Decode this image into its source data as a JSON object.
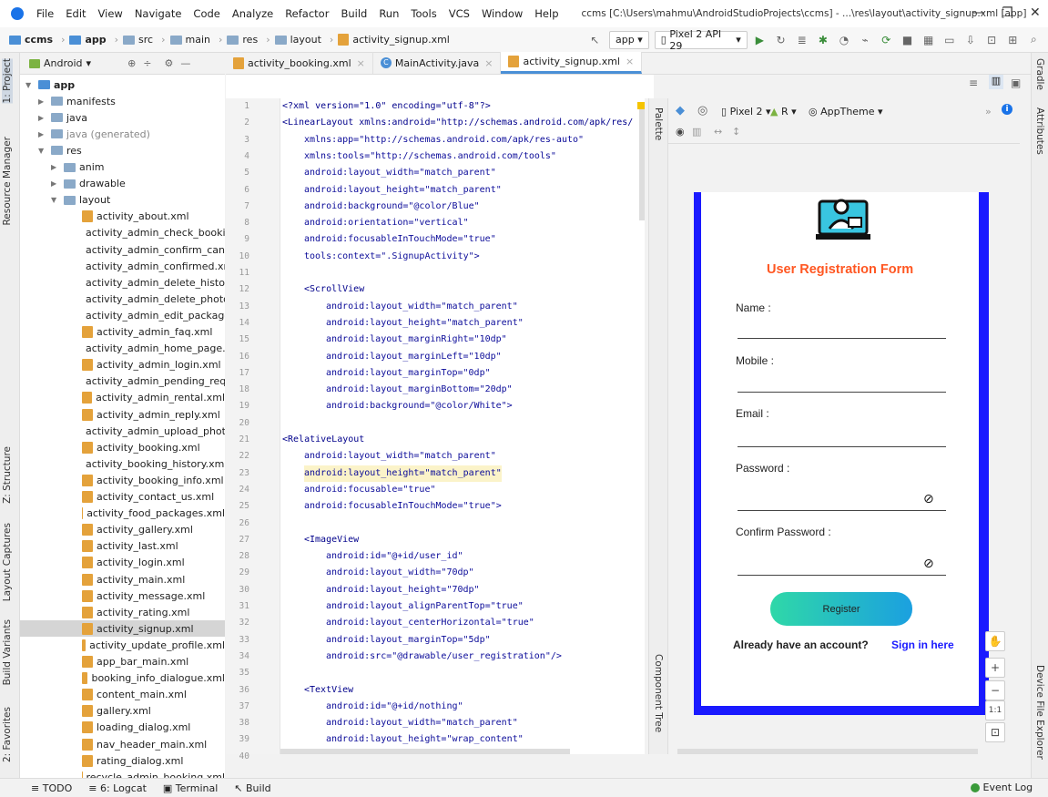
{
  "menubar": {
    "items": [
      "File",
      "Edit",
      "View",
      "Navigate",
      "Code",
      "Analyze",
      "Refactor",
      "Build",
      "Run",
      "Tools",
      "VCS",
      "Window",
      "Help"
    ],
    "title": "ccms [C:\\Users\\mahmu\\AndroidStudioProjects\\ccms] - ...\\res\\layout\\activity_signup.xml [app]"
  },
  "navbar": {
    "crumbs": [
      "ccms",
      "app",
      "src",
      "main",
      "res",
      "layout",
      "activity_signup.xml"
    ],
    "run_config": "app",
    "device": "Pixel 2 API 29"
  },
  "left_tabs": [
    "1: Project",
    "Resource Manager",
    "Z: Structure",
    "Layout Captures",
    "Build Variants",
    "2: Favorites"
  ],
  "right_tabs": [
    "Gradle",
    "Attributes",
    "Device File Explorer"
  ],
  "project": {
    "view": "Android",
    "tree": [
      {
        "label": "app",
        "level": 0,
        "open": true,
        "bold": true
      },
      {
        "label": "manifests",
        "level": 1,
        "open": false
      },
      {
        "label": "java",
        "level": 1,
        "open": false
      },
      {
        "label": "java (generated)",
        "level": 1,
        "open": false,
        "muted": true
      },
      {
        "label": "res",
        "level": 1,
        "open": true
      },
      {
        "label": "anim",
        "level": 2,
        "open": false
      },
      {
        "label": "drawable",
        "level": 2,
        "open": false
      },
      {
        "label": "layout",
        "level": 2,
        "open": true
      }
    ],
    "files": [
      "activity_about.xml",
      "activity_admin_check_bookir",
      "activity_admin_confirm_canc",
      "activity_admin_confirmed.xr",
      "activity_admin_delete_history",
      "activity_admin_delete_photo",
      "activity_admin_edit_package",
      "activity_admin_faq.xml",
      "activity_admin_home_page.xml",
      "activity_admin_login.xml",
      "activity_admin_pending_requ",
      "activity_admin_rental.xml",
      "activity_admin_reply.xml",
      "activity_admin_upload_phote",
      "activity_booking.xml",
      "activity_booking_history.xml",
      "activity_booking_info.xml",
      "activity_contact_us.xml",
      "activity_food_packages.xml",
      "activity_gallery.xml",
      "activity_last.xml",
      "activity_login.xml",
      "activity_main.xml",
      "activity_message.xml",
      "activity_rating.xml",
      "activity_signup.xml",
      "activity_update_profile.xml",
      "app_bar_main.xml",
      "booking_info_dialogue.xml",
      "content_main.xml",
      "gallery.xml",
      "loading_dialog.xml",
      "nav_header_main.xml",
      "rating_dialog.xml",
      "recycle_admin_booking.xml"
    ],
    "selected": "activity_signup.xml"
  },
  "tabs": [
    {
      "label": "activity_booking.xml",
      "active": false
    },
    {
      "label": "MainActivity.java",
      "active": false
    },
    {
      "label": "activity_signup.xml",
      "active": true
    }
  ],
  "code": [
    {
      "n": "1",
      "t": "<?xml version=\"1.0\" encoding=\"utf-8\"?>",
      "i": 0
    },
    {
      "n": "2",
      "t": "<LinearLayout xmlns:android=\"http://schemas.android.com/apk/res/",
      "i": 0
    },
    {
      "n": "3",
      "t": "xmlns:app=\"http://schemas.android.com/apk/res-auto\"",
      "i": 1
    },
    {
      "n": "4",
      "t": "xmlns:tools=\"http://schemas.android.com/tools\"",
      "i": 1
    },
    {
      "n": "5",
      "t": "android:layout_width=\"match_parent\"",
      "i": 1
    },
    {
      "n": "6",
      "t": "android:layout_height=\"match_parent\"",
      "i": 1
    },
    {
      "n": "7",
      "t": "android:background=\"@color/Blue\"",
      "i": 1
    },
    {
      "n": "8",
      "t": "android:orientation=\"vertical\"",
      "i": 1
    },
    {
      "n": "9",
      "t": "android:focusableInTouchMode=\"true\"",
      "i": 1
    },
    {
      "n": "10",
      "t": "tools:context=\".SignupActivity\">",
      "i": 1
    },
    {
      "n": "11",
      "t": "",
      "i": 0
    },
    {
      "n": "12",
      "t": "<ScrollView",
      "i": 1
    },
    {
      "n": "13",
      "t": "android:layout_width=\"match_parent\"",
      "i": 2
    },
    {
      "n": "14",
      "t": "android:layout_height=\"match_parent\"",
      "i": 2
    },
    {
      "n": "15",
      "t": "android:layout_marginRight=\"10dp\"",
      "i": 2
    },
    {
      "n": "16",
      "t": "android:layout_marginLeft=\"10dp\"",
      "i": 2
    },
    {
      "n": "17",
      "t": "android:layout_marginTop=\"0dp\"",
      "i": 2
    },
    {
      "n": "18",
      "t": "android:layout_marginBottom=\"20dp\"",
      "i": 2
    },
    {
      "n": "19",
      "t": "android:background=\"@color/White\">",
      "i": 2
    },
    {
      "n": "20",
      "t": "",
      "i": 0
    },
    {
      "n": "21",
      "t": "<RelativeLayout",
      "i": 0
    },
    {
      "n": "22",
      "t": "android:layout_width=\"match_parent\"",
      "i": 1
    },
    {
      "n": "23",
      "t": "android:layout_height=\"match_parent\"",
      "i": 1,
      "hl": true
    },
    {
      "n": "24",
      "t": "android:focusable=\"true\"",
      "i": 1
    },
    {
      "n": "25",
      "t": "android:focusableInTouchMode=\"true\">",
      "i": 1
    },
    {
      "n": "26",
      "t": "",
      "i": 0
    },
    {
      "n": "27",
      "t": "<ImageView",
      "i": 1
    },
    {
      "n": "28",
      "t": "android:id=\"@+id/user_id\"",
      "i": 2
    },
    {
      "n": "29",
      "t": "android:layout_width=\"70dp\"",
      "i": 2
    },
    {
      "n": "30",
      "t": "android:layout_height=\"70dp\"",
      "i": 2
    },
    {
      "n": "31",
      "t": "android:layout_alignParentTop=\"true\"",
      "i": 2
    },
    {
      "n": "32",
      "t": "android:layout_centerHorizontal=\"true\"",
      "i": 2
    },
    {
      "n": "33",
      "t": "android:layout_marginTop=\"5dp\"",
      "i": 2
    },
    {
      "n": "34",
      "t": "android:src=\"@drawable/user_registration\"/>",
      "i": 2
    },
    {
      "n": "35",
      "t": "",
      "i": 0
    },
    {
      "n": "36",
      "t": "<TextView",
      "i": 1
    },
    {
      "n": "37",
      "t": "android:id=\"@+id/nothing\"",
      "i": 2
    },
    {
      "n": "38",
      "t": "android:layout_width=\"match_parent\"",
      "i": 2
    },
    {
      "n": "39",
      "t": "android:layout_height=\"wrap_content\"",
      "i": 2
    },
    {
      "n": "40",
      "t": "android:layout_below=\"@+id/user_id\"",
      "i": 2
    }
  ],
  "design": {
    "palette_label": "Palette",
    "component_tree_label": "Component Tree",
    "device": "Pixel 2",
    "api": "R",
    "theme": "AppTheme",
    "form": {
      "title": "User Registration Form",
      "title_color": "#ff5722",
      "fields": [
        "Name :",
        "Mobile :",
        "Email :",
        "Password :",
        "Confirm Password :"
      ],
      "button": "Register",
      "footer_text": "Already have an account?",
      "footer_link": "Sign in here",
      "link_color": "#1a1aff"
    },
    "zoom_label": "1:1"
  },
  "bottombar": {
    "items": [
      "TODO",
      "6: Logcat",
      "Terminal",
      "Build"
    ],
    "event_log": "Event Log"
  }
}
